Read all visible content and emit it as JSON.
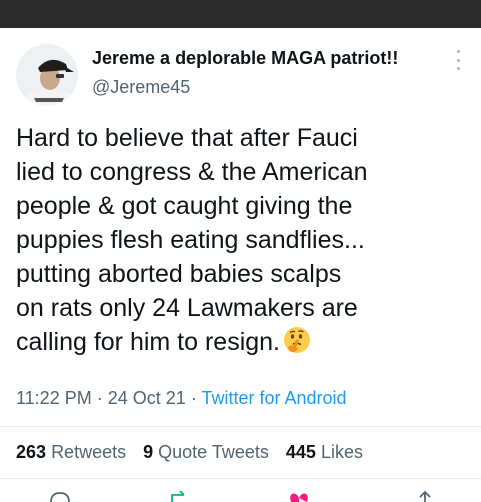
{
  "tweet": {
    "author_name": "Jereme a deplorable MAGA patriot!!",
    "handle": "@Jereme45",
    "text_lines": [
      "Hard to believe that after Fauci",
      "lied to congress & the American",
      "people & got caught giving the",
      "puppies flesh eating sandflies...",
      "putting aborted babies scalps",
      "on rats only 24 Lawmakers are",
      "calling for him to resign."
    ],
    "emoji": "thinking-face-icon",
    "time": "11:22 PM",
    "date": "24 Oct 21",
    "separator": "·",
    "source": "Twitter for Android"
  },
  "stats": {
    "retweets_count": "263",
    "retweets_label": "Retweets",
    "quotes_count": "9",
    "quotes_label": "Quote Tweets",
    "likes_count": "445",
    "likes_label": "Likes"
  },
  "colors": {
    "text": "#0f1419",
    "secondary": "#536471",
    "link": "#1d9bf0",
    "like": "#f91880",
    "retweet": "#00ba7c"
  }
}
